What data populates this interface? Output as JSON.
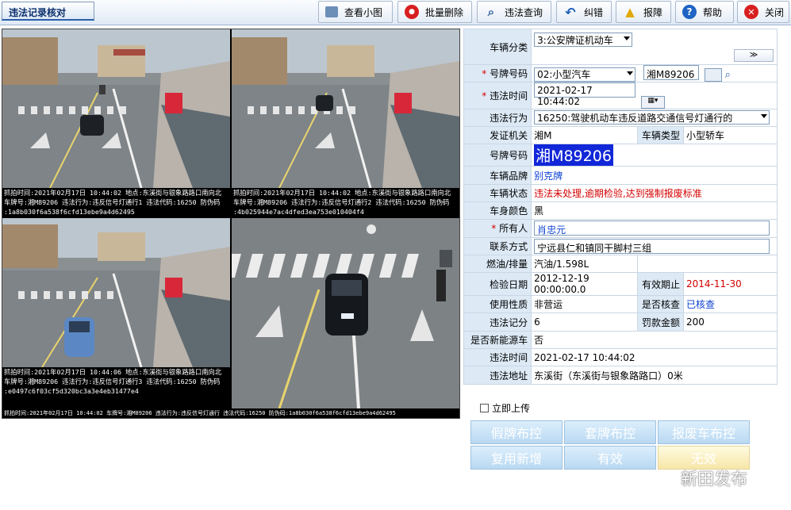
{
  "window": {
    "title": "违法记录核对"
  },
  "toolbar": {
    "buttons": [
      {
        "label": "查看小图",
        "icon": "image-icon"
      },
      {
        "label": "批量删除",
        "icon": "stop-icon"
      },
      {
        "label": "违法查询",
        "icon": "search-icon"
      },
      {
        "label": "纠错",
        "icon": "undo-icon"
      },
      {
        "label": "报障",
        "icon": "warning-icon"
      },
      {
        "label": "帮助",
        "icon": "help-icon"
      },
      {
        "label": "关闭",
        "icon": "close-icon"
      }
    ]
  },
  "captures": {
    "top_line1": "抓拍时间:2021年02月17日  10:44:02  地点:东溪街与银象路路口南向北",
    "top_line1b": "抓拍时间:2021年02月17日  10:44:02  地点:东溪街与银象路路口南向北",
    "top_line2": "车牌号:湘M89206  违法行为:违反信号灯通行1  违法代码:16250  防伪码",
    "top_line2b": "车牌号:湘M89206  违法行为:违反信号灯通行2  违法代码:16250  防伪码",
    "top_line3": ":1a8b030f6a538f6cfd13ebe9a4d62495",
    "top_line3b": ":4b025944e7ac4dfed3ea753e010404f4",
    "bottom_line1": "抓拍时间:2021年02月17日  10:44:06  地点:东溪街与银象路路口南向北",
    "bottom_line2": "车牌号:湘M89206  违法行为:违反信号灯通行3  违法代码:16250  防伪码",
    "bottom_line3": ":e0497c6f03cf5d320bc3a3e4eb31477e4",
    "strip": "抓拍时间:2021年02月17日  10:44:02  车牌号:湘M89206  违法行为:违反信号灯通行  违法代码:16250  防伪码:1a8b030f6a538f6cfd13ebe9a4d62495"
  },
  "form": {
    "vehicle_category_label": "车辆分类",
    "vehicle_category": "3:公安牌证机动车",
    "plate_label": "号牌号码",
    "plate_type": "02:小型汽车",
    "plate_number": "湘M89206",
    "violation_time_label": "违法时间",
    "violation_time": "2021-02-17  10:44:02",
    "violation_behavior_label": "违法行为",
    "violation_behavior": "16250:驾驶机动车违反道路交通信号灯通行的",
    "issuing_authority_label": "发证机关",
    "issuing_authority": "湘M",
    "vehicle_type_label": "车辆类型",
    "vehicle_type": "小型轿车",
    "plate_label2": "号牌号码",
    "plate_big": "湘M89206",
    "brand_label": "车辆品牌",
    "brand": "别克牌",
    "status_label": "车辆状态",
    "status": "违法未处理,逾期检验,达到强制报废标准",
    "color_label": "车身颜色",
    "color": "黑",
    "owner_label": "所有人",
    "owner": "肖忠元",
    "contact_label": "联系方式",
    "contact": "宁远县仁和镇同干脚村三组",
    "fuel_label": "燃油/排量",
    "fuel": "汽油/1.598L",
    "inspection_date_label": "检验日期",
    "inspection_date": "2012-12-19 00:00:00.0",
    "valid_until_label": "有效期止",
    "valid_until": "2014-11-30",
    "usage_label": "使用性质",
    "usage": "非营运",
    "verified_label": "是否核查",
    "verified": "已核查",
    "points_label": "违法记分",
    "points": "6",
    "fine_label": "罚款金额",
    "fine": "200",
    "new_energy_label": "是否新能源车",
    "new_energy": "否",
    "time2_label": "违法时间",
    "time2": "2021-02-17 10:44:02",
    "address_label": "违法地址",
    "address": "东溪街（东溪街与银象路路口）0米"
  },
  "upload_now": "立即上传",
  "actions": {
    "fake_plate": "假牌布控",
    "cloned_plate": "套牌布控",
    "scrapped": "报废车布控",
    "reuse_new": "复用新增",
    "valid": "有效",
    "invalid": "无效"
  },
  "watermark": "新田发布",
  "colors": {
    "label_bg": "#ddeaf6",
    "accent_red": "#d40000",
    "link_blue": "#0b3fd1",
    "plate_highlight": "#1127d8"
  }
}
